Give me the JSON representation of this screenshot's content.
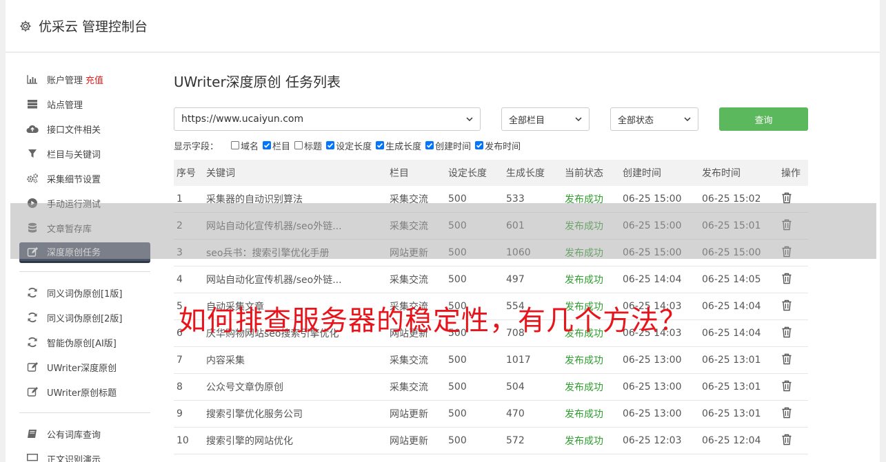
{
  "header": {
    "title": "优采云 管理控制台",
    "icon": "gear-icon"
  },
  "sidebar": {
    "group1": [
      {
        "label": "账户管理",
        "accent": "充值",
        "icon": "bar-chart-icon"
      },
      {
        "label": "站点管理",
        "icon": "server-icon"
      },
      {
        "label": "接口文件相关",
        "icon": "cloud-upload-icon"
      },
      {
        "label": "栏目与关键词",
        "icon": "filter-icon"
      },
      {
        "label": "采集细节设置",
        "icon": "cogs-icon"
      },
      {
        "label": "手动运行测试",
        "icon": "play-circle-icon"
      },
      {
        "label": "文章暂存库",
        "icon": "database-icon"
      },
      {
        "label": "深度原创任务",
        "icon": "edit-icon",
        "active": true
      }
    ],
    "group2": [
      {
        "label": "同义词伪原创[1版]",
        "icon": "refresh-icon"
      },
      {
        "label": "同义词伪原创[2版]",
        "icon": "refresh-icon"
      },
      {
        "label": "智能伪原创[AI版]",
        "icon": "refresh-icon"
      },
      {
        "label": "UWriter深度原创",
        "icon": "edit-icon"
      },
      {
        "label": "UWriter原创标题",
        "icon": "edit-icon"
      }
    ],
    "group3": [
      {
        "label": "公有词库查询",
        "icon": "book-icon"
      },
      {
        "label": "正文识别演示",
        "icon": "monitor-icon"
      }
    ]
  },
  "page": {
    "title": "UWriter深度原创 任务列表"
  },
  "filters": {
    "site": "https://www.ucaiyun.com",
    "column": "全部栏目",
    "status": "全部状态",
    "query_label": "查询"
  },
  "fields": {
    "label": "显示字段：",
    "items": [
      {
        "label": "域名",
        "checked": false
      },
      {
        "label": "栏目",
        "checked": true
      },
      {
        "label": "标题",
        "checked": false
      },
      {
        "label": "设定长度",
        "checked": true
      },
      {
        "label": "生成长度",
        "checked": true
      },
      {
        "label": "创建时间",
        "checked": true
      },
      {
        "label": "发布时间",
        "checked": true
      }
    ]
  },
  "table": {
    "headers": [
      "序号",
      "关键词",
      "栏目",
      "设定长度",
      "生成长度",
      "当前状态",
      "创建时间",
      "发布时间",
      "操作"
    ],
    "rows": [
      [
        "1",
        "采集器的自动识别算法",
        "采集交流",
        "500",
        "533",
        "发布成功",
        "06-25 15:00",
        "06-25 15:02"
      ],
      [
        "2",
        "网站自动化宣传机器/seo外链...",
        "采集交流",
        "500",
        "601",
        "发布成功",
        "06-25 15:00",
        "06-25 15:01"
      ],
      [
        "3",
        "seo兵书：搜索引擎优化手册",
        "网站更新",
        "500",
        "1060",
        "发布成功",
        "06-25 15:00",
        "06-25 15:00"
      ],
      [
        "4",
        "网站自动化宣传机器/seo外链...",
        "采集交流",
        "500",
        "497",
        "发布成功",
        "06-25 14:04",
        "06-25 14:05"
      ],
      [
        "5",
        "自动采集文章",
        "采集交流",
        "500",
        "554",
        "发布成功",
        "06-25 14:03",
        "06-25 14:04"
      ],
      [
        "6",
        "庆华购物网站seo搜索引擎优化",
        "网站更新",
        "500",
        "708",
        "发布成功",
        "06-25 14:03",
        "06-25 14:04"
      ],
      [
        "7",
        "内容采集",
        "采集交流",
        "500",
        "1017",
        "发布成功",
        "06-25 13:00",
        "06-25 13:01"
      ],
      [
        "8",
        "公众号文章伪原创",
        "采集交流",
        "500",
        "504",
        "发布成功",
        "06-25 13:00",
        "06-25 13:01"
      ],
      [
        "9",
        "搜索引擎优化服务公司",
        "网站更新",
        "500",
        "470",
        "发布成功",
        "06-25 13:00",
        "06-25 13:01"
      ],
      [
        "10",
        "搜索引擎的网站优化",
        "网站更新",
        "500",
        "572",
        "发布成功",
        "06-25 12:03",
        "06-25 12:04"
      ]
    ]
  },
  "overlay": {
    "text": "如何排查服务器的稳定性，有几个方法？"
  }
}
